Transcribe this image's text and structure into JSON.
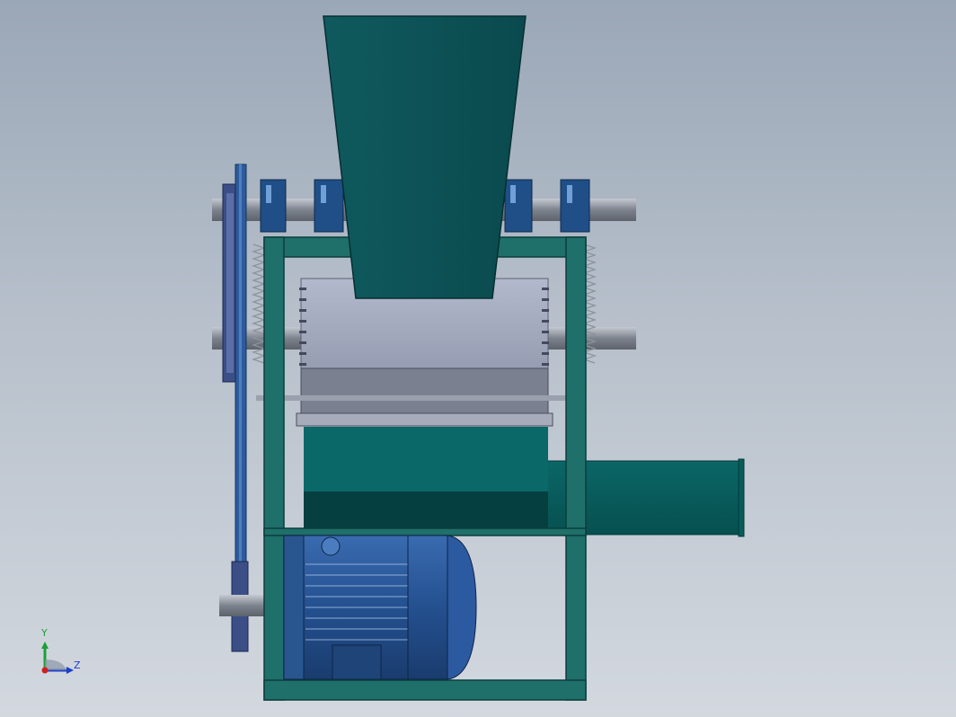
{
  "view": {
    "background_top": "#9aa7b7",
    "background_bottom": "#d3d8df"
  },
  "colors": {
    "frame_teal": "#1f6f6a",
    "hopper_teal": "#0d5458",
    "chamber_gray": "#9ea6bc",
    "motor_blue": "#27538f",
    "shaft_gray": "#8a8f99",
    "belt_blue": "#2d5b9b"
  },
  "axis_triad": {
    "y_label": "Y",
    "z_label": "Z",
    "icon": "coordinate-triad-icon"
  }
}
